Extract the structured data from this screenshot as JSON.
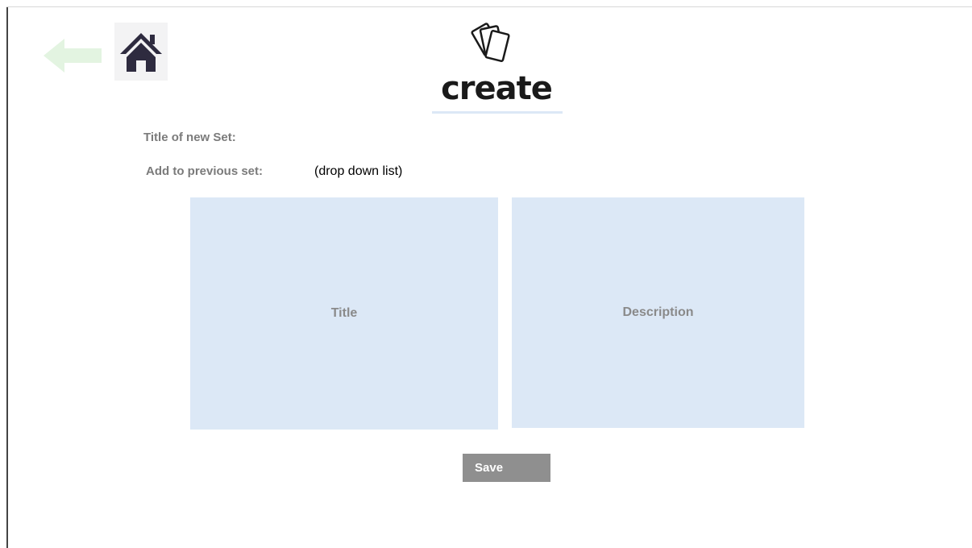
{
  "app": {
    "logo_text": "create"
  },
  "nav": {
    "back_icon": "arrow-left-icon",
    "home_icon": "home-icon"
  },
  "form": {
    "title_label": "Title of new Set:",
    "previous_set_label": "Add to previous set:",
    "previous_set_value": "(drop down list)"
  },
  "cards": {
    "title_placeholder": "Title",
    "description_placeholder": "Description"
  },
  "actions": {
    "save_label": "Save"
  },
  "colors": {
    "accent_light_blue": "#dce8f6",
    "back_arrow_green": "#e3f4e1",
    "home_icon_dark": "#2e2b3f",
    "save_button_gray": "#8f8f8f",
    "label_gray": "#7b7b7b"
  }
}
